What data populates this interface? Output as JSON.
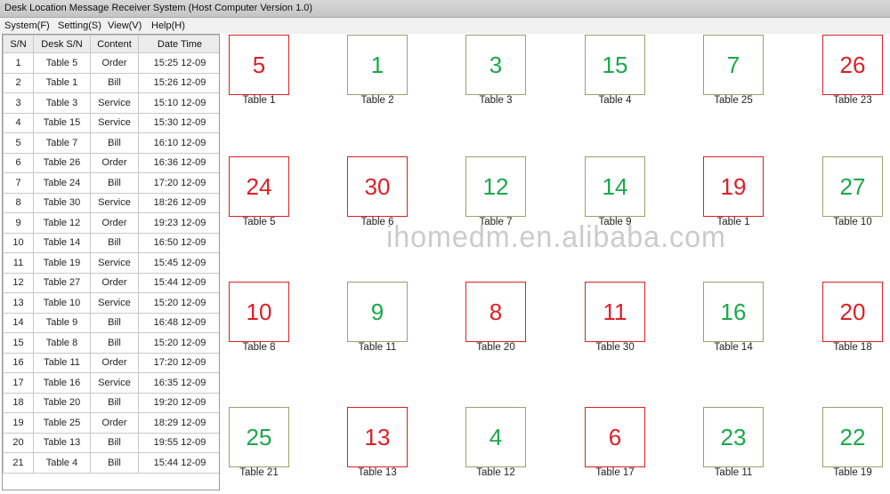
{
  "window": {
    "title": "Desk Location Message Receiver System (Host Computer Version 1.0)"
  },
  "menu": [
    "System(F)",
    "Setting(S)",
    "View(V)",
    "Help(H)"
  ],
  "table": {
    "columns": [
      "S/N",
      "Desk S/N",
      "Content",
      "Date Time"
    ],
    "rows": [
      [
        "1",
        "Table 5",
        "Order",
        "15:25  12-09"
      ],
      [
        "2",
        "Table 1",
        "Bill",
        "15:26 12-09"
      ],
      [
        "3",
        "Table 3",
        "Service",
        "15:10  12-09"
      ],
      [
        "4",
        "Table 15",
        "Service",
        "15:30  12-09"
      ],
      [
        "5",
        "Table 7",
        "Bill",
        "16:10  12-09"
      ],
      [
        "6",
        "Table 26",
        "Order",
        "16:36  12-09"
      ],
      [
        "7",
        "Table 24",
        "Bill",
        "17:20  12-09"
      ],
      [
        "8",
        "Table 30",
        "Service",
        "18:26 12-09"
      ],
      [
        "9",
        "Table 12",
        "Order",
        "19:23  12-09"
      ],
      [
        "10",
        "Table 14",
        "Bill",
        "16:50  12-09"
      ],
      [
        "11",
        "Table 19",
        "Service",
        "15:45 12-09"
      ],
      [
        "12",
        "Table 27",
        "Order",
        "15:44  12-09"
      ],
      [
        "13",
        "Table 10",
        "Service",
        "15:20  12-09"
      ],
      [
        "14",
        "Table 9",
        "Bill",
        "16:48  12-09"
      ],
      [
        "15",
        "Table 8",
        "Bill",
        "15:20  12-09"
      ],
      [
        "16",
        "Table 11",
        "Order",
        "17:20  12-09"
      ],
      [
        "17",
        "Table 16",
        "Service",
        "16:35  12-09"
      ],
      [
        "18",
        "Table 20",
        "Bill",
        "19:20  12-09"
      ],
      [
        "19",
        "Table 25",
        "Order",
        "18:29  12-09"
      ],
      [
        "20",
        "Table 13",
        "Bill",
        "19:55  12-09"
      ],
      [
        "21",
        "Table 4",
        "Bill",
        "15:44  12-09"
      ]
    ]
  },
  "colors": {
    "red": "#dd1f26",
    "green": "#1aa84a",
    "red_border": "#dd1f26",
    "green_border": "#9aa070"
  },
  "tiles": [
    [
      {
        "num": "5",
        "label": "Table 1",
        "status": "red"
      },
      {
        "num": "1",
        "label": "Table 2",
        "status": "green"
      },
      {
        "num": "3",
        "label": "Table 3",
        "status": "green"
      },
      {
        "num": "15",
        "label": "Table 4",
        "status": "green"
      },
      {
        "num": "7",
        "label": "Table 25",
        "status": "green"
      },
      {
        "num": "26",
        "label": "Table 23",
        "status": "red"
      }
    ],
    [
      {
        "num": "24",
        "label": "Table 5",
        "status": "red"
      },
      {
        "num": "30",
        "label": "Table 6",
        "status": "red"
      },
      {
        "num": "12",
        "label": "Table 7",
        "status": "green"
      },
      {
        "num": "14",
        "label": "Table 9",
        "status": "green"
      },
      {
        "num": "19",
        "label": "Table 1",
        "status": "red"
      },
      {
        "num": "27",
        "label": "Table 10",
        "status": "green"
      }
    ],
    [
      {
        "num": "10",
        "label": "Table 8",
        "status": "red"
      },
      {
        "num": "9",
        "label": "Table 11",
        "status": "green"
      },
      {
        "num": "8",
        "label": "Table 20",
        "status": "red"
      },
      {
        "num": "11",
        "label": "Table 30",
        "status": "red"
      },
      {
        "num": "16",
        "label": "Table 14",
        "status": "green"
      },
      {
        "num": "20",
        "label": "Table 18",
        "status": "red"
      }
    ],
    [
      {
        "num": "25",
        "label": "Table 21",
        "status": "green"
      },
      {
        "num": "13",
        "label": "Table 13",
        "status": "red"
      },
      {
        "num": "4",
        "label": "Table 12",
        "status": "green"
      },
      {
        "num": "6",
        "label": "Table 17",
        "status": "red"
      },
      {
        "num": "23",
        "label": "Table 11",
        "status": "green"
      },
      {
        "num": "22",
        "label": "Table 19",
        "status": "green"
      }
    ]
  ],
  "watermark": "ihomedm.en.alibaba.com"
}
